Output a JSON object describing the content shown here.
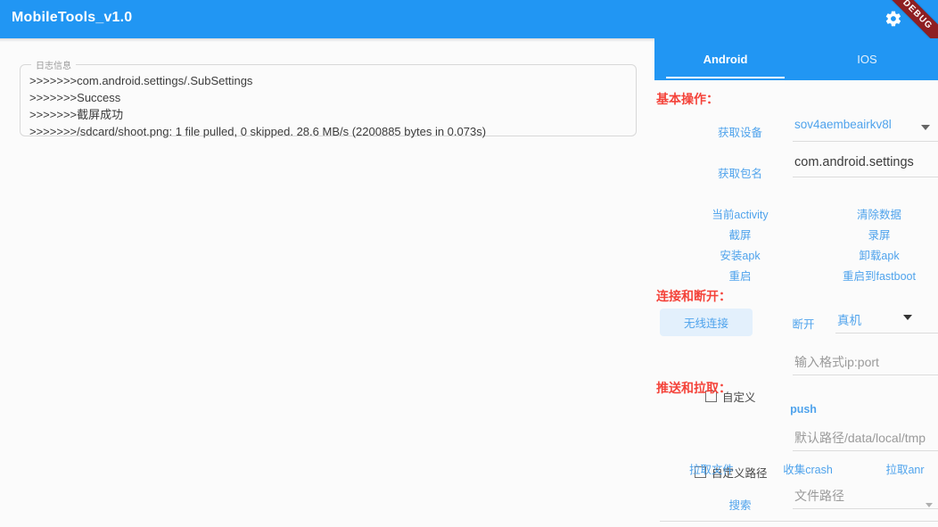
{
  "window": {
    "title": "MobileTools_v1.0",
    "debug_badge": "DEBUG",
    "gear_icon": "gear-icon",
    "accent_color": "#2196f3",
    "debug_color": "#8e1f22"
  },
  "log_panel": {
    "legend": "日志信息",
    "lines": [
      ">>>>>>>com.android.settings/.SubSettings",
      ">>>>>>>Success",
      ">>>>>>>截屏成功",
      ">>>>>>>/sdcard/shoot.png: 1 file pulled, 0 skipped. 28.6 MB/s (2200885 bytes in 0.073s)"
    ]
  },
  "tabs": [
    {
      "label": "Android",
      "active": true
    },
    {
      "label": "IOS",
      "active": false
    }
  ],
  "sections": {
    "basic": {
      "title": "基本操作：",
      "get_device_label": "获取设备",
      "device_value": "sov4aembeairkv8l",
      "get_package_label": "获取包名",
      "package_value": "com.android.settings",
      "buttons": [
        "当前activity",
        "清除数据",
        "截屏",
        "录屏",
        "安装apk",
        "卸载apk",
        "重启",
        "重启到fastboot"
      ]
    },
    "connect": {
      "title": "连接和断开：",
      "wireless_label": "无线连接",
      "disconnect_label": "断开",
      "device_type_value": "真机",
      "custom_label": "自定义",
      "ip_placeholder": "输入格式ip:port"
    },
    "transfer": {
      "title": "推送和拉取：",
      "push_label": "push",
      "custom_path_label": "自定义路径",
      "path_placeholder": "默认路径/data/local/tmp",
      "pull_file_label": "拉取文件",
      "collect_crash_label": "收集crash",
      "pull_anr_label": "拉取anr",
      "search_label": "搜索",
      "file_path_placeholder": "文件路径"
    }
  }
}
